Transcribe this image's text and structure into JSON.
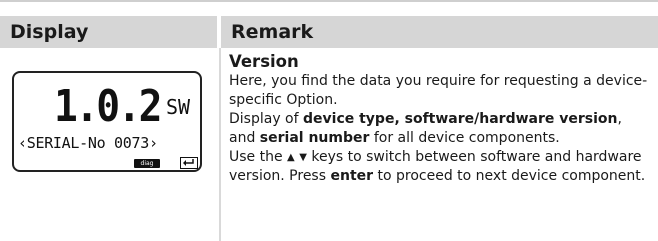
{
  "table": {
    "headers": {
      "display": "Display",
      "remark": "Remark"
    }
  },
  "lcd": {
    "main_value": "1.0.2",
    "unit": "SW",
    "scroll_text": "‹SERIAL-No 0073›",
    "badge": "diag",
    "enter_icon": "enter-return-icon"
  },
  "remark": {
    "title": "Version",
    "p1": "Here, you find the data you require for requesting a device-specific Option.",
    "p2": {
      "a": "Display of ",
      "b_bold": "device type, software/hardware version",
      "c": ", and ",
      "d_bold": "serial number",
      "e": " for all device components."
    },
    "p3": {
      "a": "Use the ",
      "up": "▲",
      "down": "▼",
      "b": "  keys to switch between software and hardware version. Press ",
      "c_bold": "enter",
      "d": " to proceed to next device component."
    }
  }
}
